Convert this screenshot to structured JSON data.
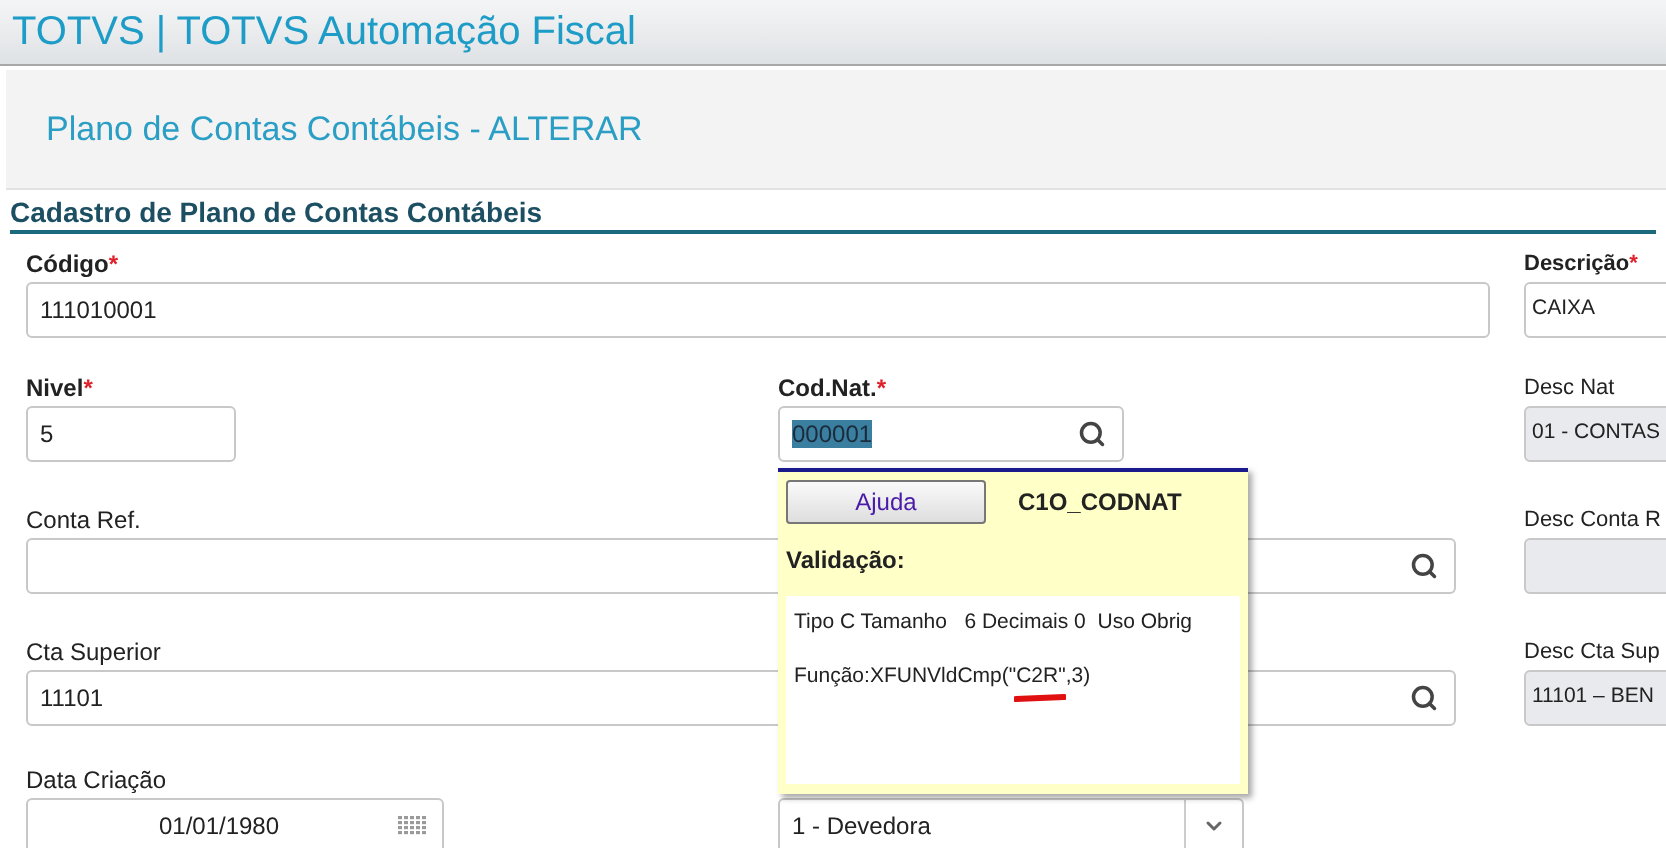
{
  "app_bar": {
    "title": "TOTVS | TOTVS Automação Fiscal"
  },
  "page": {
    "title": "Plano de Contas Contábeis - ALTERAR"
  },
  "section": {
    "title": "Cadastro de Plano de Contas Contábeis"
  },
  "rows": [
    {
      "main": [
        {
          "kind": "text",
          "label": "Código",
          "required_mark": "*",
          "value": "111010001"
        }
      ],
      "side": {
        "label": "Descrição",
        "required_mark": "*",
        "value": "CAIXA",
        "readonly": false
      }
    },
    {
      "main": [
        {
          "kind": "text",
          "label": "Nivel",
          "required_mark": "*",
          "value": "5"
        },
        {
          "kind": "lookup",
          "label": "Cod.Nat.",
          "required_mark": "*",
          "value": "000001",
          "text_selected": true
        }
      ],
      "side": {
        "label": "Desc Nat",
        "value": "01 - CONTAS",
        "readonly": true
      }
    },
    {
      "main": [
        {
          "kind": "lookup",
          "label": "Conta Ref."
        }
      ],
      "side": {
        "label": "Desc Conta R",
        "readonly": true
      }
    },
    {
      "main": [
        {
          "kind": "lookup",
          "label": "Cta Superior",
          "value": "11101"
        }
      ],
      "side": {
        "label": "Desc Cta Sup",
        "value": "11101 – BEN",
        "readonly": true
      }
    },
    {
      "main": [
        {
          "kind": "date",
          "label": "Data Criação",
          "value": "01/01/1980"
        },
        {
          "kind": "select",
          "value": "1 - Devedora"
        }
      ]
    }
  ],
  "help_popup": {
    "button": "Ajuda",
    "field_id": "C1O_CODNAT",
    "heading": "Validação:",
    "info": "Tipo C Tamanho   6 Decimais 0  Uso Obrig",
    "function": "Função:XFUNVldCmp(\"C2R\",3)"
  }
}
